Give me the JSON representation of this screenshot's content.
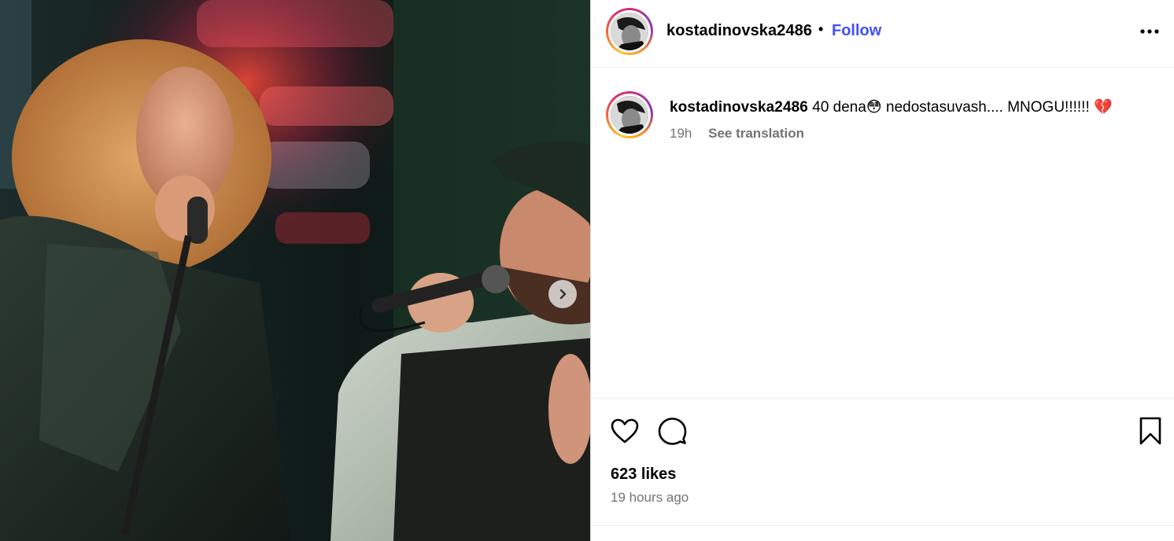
{
  "post": {
    "username": "kostadinovska2486",
    "follow_label": "Follow",
    "separator": "•",
    "caption": {
      "username": "kostadinovska2486",
      "text": " 40 dena😳  nedostasuvash.... MNOGU!!!!!!  💔"
    },
    "caption_time": "19h",
    "see_translation": "See translation",
    "likes": "623 likes",
    "time_ago": "19 hours ago"
  },
  "icons": {
    "more": "more-options-icon",
    "like": "heart-icon",
    "comment": "comment-bubble-icon",
    "save": "bookmark-icon",
    "next": "chevron-right-icon"
  },
  "colors": {
    "follow": "#4150f7",
    "secondary_text": "#737373",
    "divider": "#efefef"
  }
}
